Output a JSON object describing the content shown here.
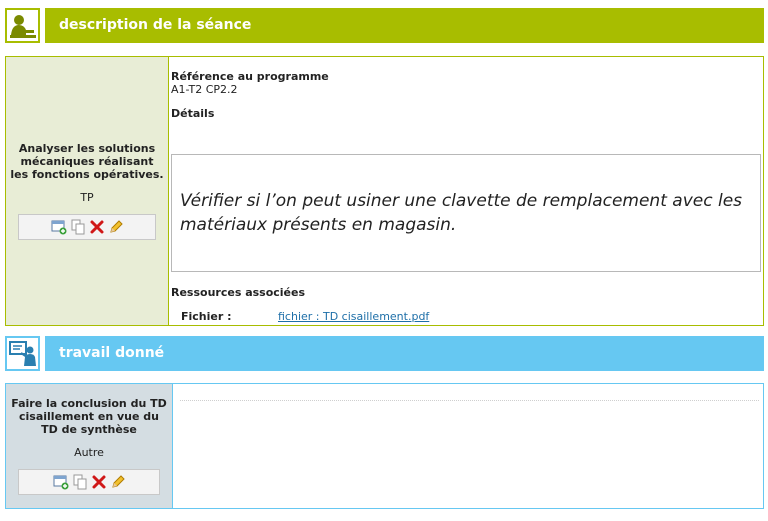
{
  "sections": {
    "description": {
      "title": "description de la séance",
      "icon": "student-at-desk-icon",
      "color": "#a8bd00"
    },
    "travail": {
      "title": "travail donné",
      "icon": "teacher-at-board-icon",
      "color": "#66c8f2"
    }
  },
  "seance": {
    "objective": "Analyser les solutions mécaniques réalisant les fonctions opératives.",
    "type": "TP",
    "reference_label": "Référence au programme",
    "reference_value": "A1-T2 CP2.2",
    "details_label": "Détails",
    "details_text": "Vérifier si l’on peut usiner une clavette de remplacement avec les matériaux présents en magasin.",
    "resources_label": "Ressources associées",
    "file_label": "Fichier :",
    "file_link": "fichier : TD cisaillement.pdf"
  },
  "travail": {
    "objective": "Faire la conclusion du TD cisaillement en vue du TD de synthèse",
    "type": "Autre"
  },
  "toolbar_icons": [
    "add-window-icon",
    "copy-icon",
    "delete-icon",
    "edit-pencil-icon"
  ]
}
